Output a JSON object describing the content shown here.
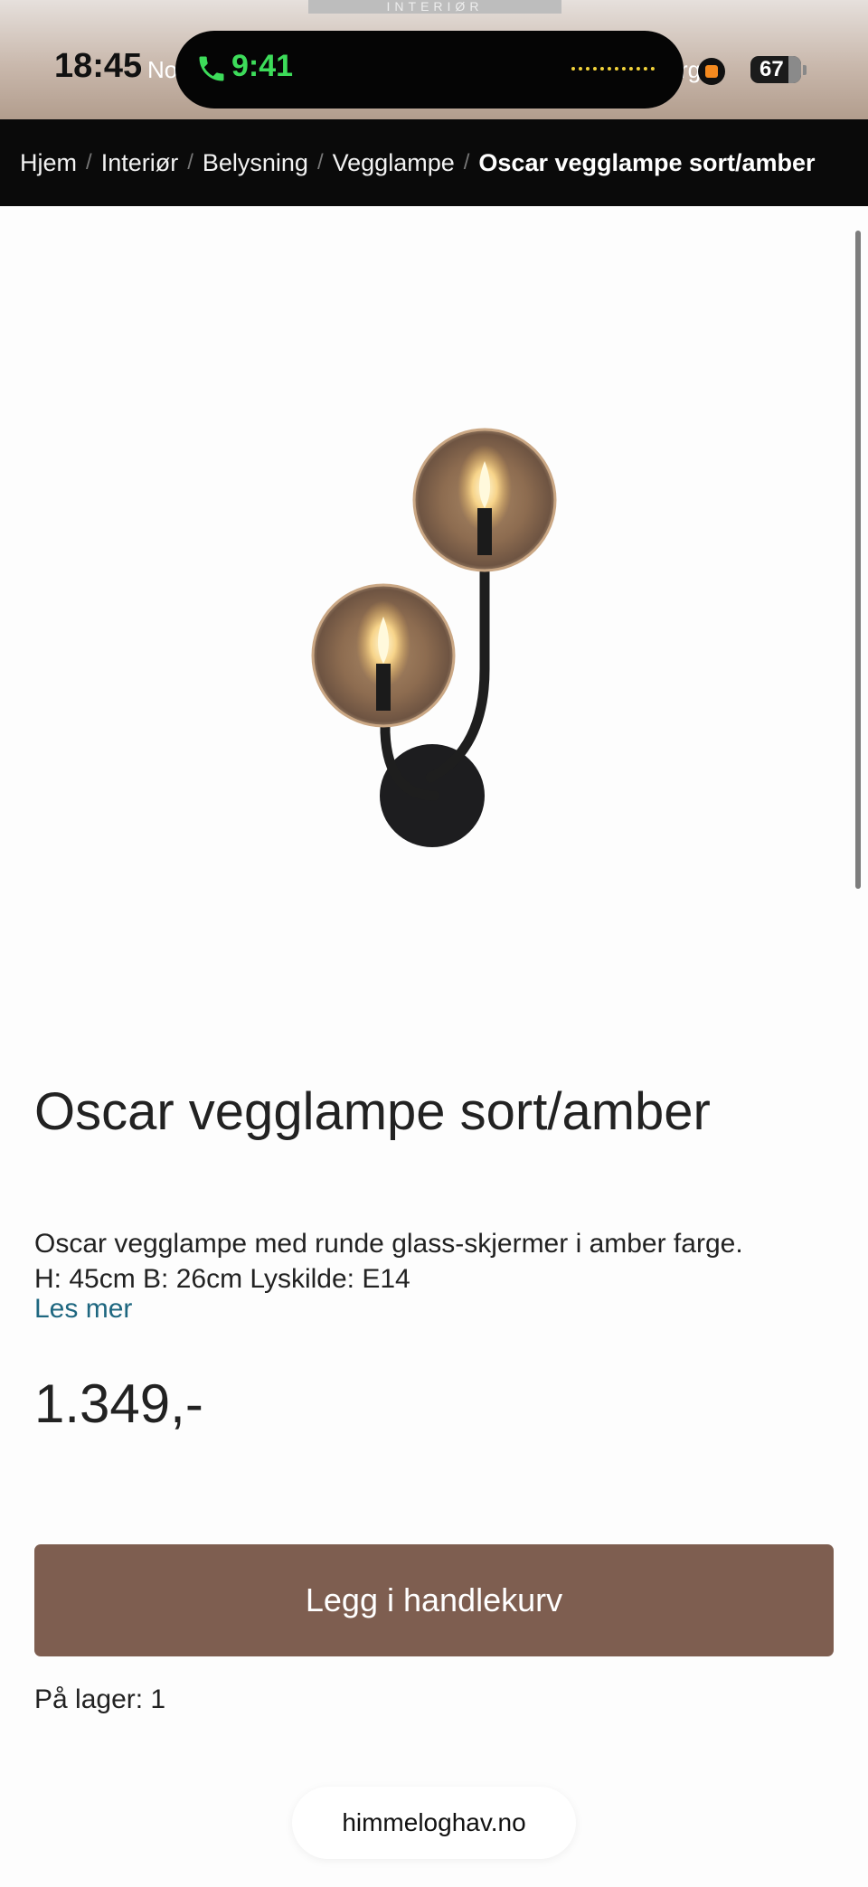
{
  "status_bar": {
    "site_logo": "INTERIØR",
    "clock": "18:45",
    "behind_left": "No",
    "behind_right": "rg",
    "call_time": "9:41",
    "battery": "67"
  },
  "breadcrumb": {
    "items": [
      "Hjem",
      "Interiør",
      "Belysning",
      "Vegglampe"
    ],
    "separator": "/",
    "current": "Oscar vegglampe sort/amber"
  },
  "product": {
    "title": "Oscar vegglampe sort/amber",
    "description_line1": "Oscar vegglampe med runde glass-skjermer i amber farge.",
    "description_line2": "H: 45cm B: 26cm Lyskilde: E14",
    "read_more": "Les mer",
    "price": "1.349,-",
    "add_to_cart": "Legg i handlekurv",
    "stock": "På lager: 1"
  },
  "browser": {
    "url": "himmeloghav.no"
  },
  "colors": {
    "button": "#7e5e50",
    "link": "#1e6780",
    "call_green": "#3ddc5a",
    "breadcrumb_bg": "#0a0a0a"
  }
}
